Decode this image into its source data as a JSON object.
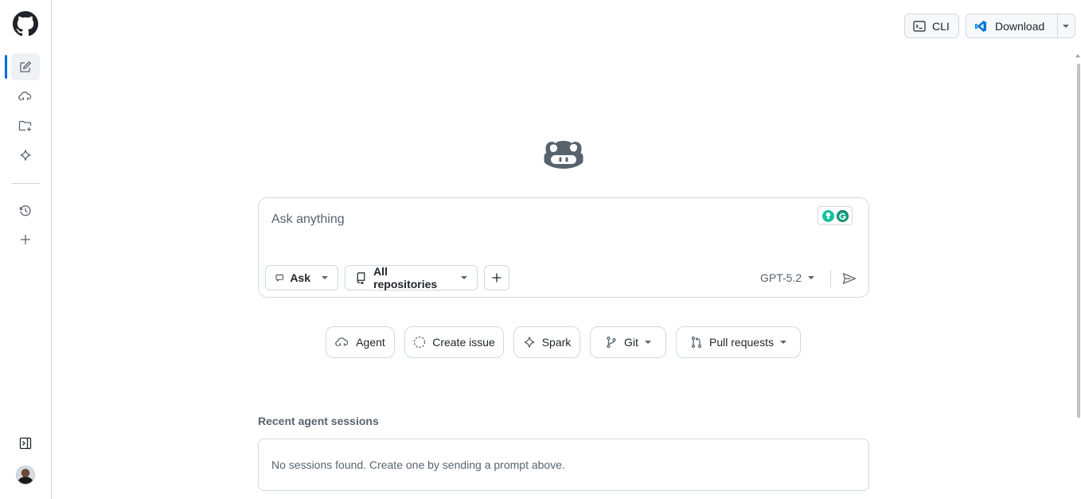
{
  "header": {
    "cli_label": "CLI",
    "download_label": "Download"
  },
  "sidebar": {
    "items": [
      {
        "name": "new-chat",
        "icon": "pencil-square-icon",
        "active": true
      },
      {
        "name": "agents",
        "icon": "cloud-agent-icon"
      },
      {
        "name": "spaces",
        "icon": "folder-plus-icon"
      },
      {
        "name": "spark",
        "icon": "spark-icon"
      },
      {
        "name": "history",
        "icon": "history-icon"
      },
      {
        "name": "new",
        "icon": "plus-icon"
      }
    ],
    "bottom": [
      {
        "name": "expand-sidebar",
        "icon": "sidebar-expand-icon"
      },
      {
        "name": "avatar",
        "icon": "avatar"
      }
    ]
  },
  "prompt": {
    "placeholder": "Ask anything",
    "mode_label": "Ask",
    "repo_label": "All repositories",
    "model_label": "GPT-5.2"
  },
  "chips": [
    {
      "label": "Agent",
      "icon": "cloud-agent-icon"
    },
    {
      "label": "Create issue",
      "icon": "dashed-circle-icon"
    },
    {
      "label": "Spark",
      "icon": "spark-icon"
    },
    {
      "label": "Git",
      "icon": "git-branch-icon"
    },
    {
      "label": "Pull requests",
      "icon": "pull-request-icon"
    }
  ],
  "recent": {
    "title": "Recent agent sessions",
    "empty_text": "No sessions found. Create one by sending a prompt above."
  },
  "colors": {
    "accent": "#0969da",
    "border": "#d1d9e0",
    "muted_text": "#59636e",
    "grammarly_green": "#15c39a",
    "vscode_blue": "#0078d4"
  }
}
